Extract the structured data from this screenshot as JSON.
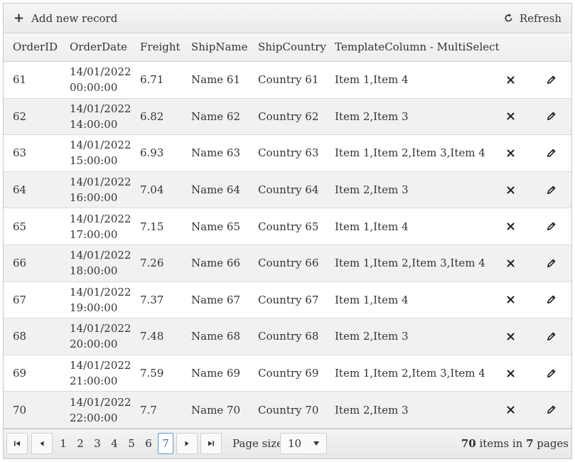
{
  "toolbar": {
    "add_label": "Add new record",
    "refresh_label": "Refresh",
    "add_icon": "+"
  },
  "columns": [
    "OrderID",
    "OrderDate",
    "Freight",
    "ShipName",
    "ShipCountry",
    "TemplateColumn - MultiSelect"
  ],
  "rows": [
    {
      "id": "61",
      "date": "14/01/2022",
      "time": "00:00:00",
      "freight": "6.71",
      "name": "Name 61",
      "country": "Country 61",
      "tpl": "Item 1,Item 4"
    },
    {
      "id": "62",
      "date": "14/01/2022",
      "time": "14:00:00",
      "freight": "6.82",
      "name": "Name 62",
      "country": "Country 62",
      "tpl": "Item 2,Item 3"
    },
    {
      "id": "63",
      "date": "14/01/2022",
      "time": "15:00:00",
      "freight": "6.93",
      "name": "Name 63",
      "country": "Country 63",
      "tpl": "Item 1,Item 2,Item 3,Item 4"
    },
    {
      "id": "64",
      "date": "14/01/2022",
      "time": "16:00:00",
      "freight": "7.04",
      "name": "Name 64",
      "country": "Country 64",
      "tpl": "Item 2,Item 3"
    },
    {
      "id": "65",
      "date": "14/01/2022",
      "time": "17:00:00",
      "freight": "7.15",
      "name": "Name 65",
      "country": "Country 65",
      "tpl": "Item 1,Item 4"
    },
    {
      "id": "66",
      "date": "14/01/2022",
      "time": "18:00:00",
      "freight": "7.26",
      "name": "Name 66",
      "country": "Country 66",
      "tpl": "Item 1,Item 2,Item 3,Item 4"
    },
    {
      "id": "67",
      "date": "14/01/2022",
      "time": "19:00:00",
      "freight": "7.37",
      "name": "Name 67",
      "country": "Country 67",
      "tpl": "Item 1,Item 4"
    },
    {
      "id": "68",
      "date": "14/01/2022",
      "time": "20:00:00",
      "freight": "7.48",
      "name": "Name 68",
      "country": "Country 68",
      "tpl": "Item 2,Item 3"
    },
    {
      "id": "69",
      "date": "14/01/2022",
      "time": "21:00:00",
      "freight": "7.59",
      "name": "Name 69",
      "country": "Country 69",
      "tpl": "Item 1,Item 2,Item 3,Item 4"
    },
    {
      "id": "70",
      "date": "14/01/2022",
      "time": "22:00:00",
      "freight": "7.7",
      "name": "Name 70",
      "country": "Country 70",
      "tpl": "Item 2,Item 3"
    }
  ],
  "row_actions": {
    "delete_icon": "close-icon",
    "edit_icon": "pencil-icon"
  },
  "pager": {
    "pages": [
      "1",
      "2",
      "3",
      "4",
      "5",
      "6",
      "7"
    ],
    "current_page": "7",
    "page_size_label": "Page size:",
    "page_size": "10",
    "info_total": "70",
    "info_mid": " items in ",
    "info_pages": "7",
    "info_end": " pages"
  },
  "colors": {
    "accent": "#3a78c2",
    "row_alt": "#f1f1f1",
    "border": "#c8c8c8"
  }
}
